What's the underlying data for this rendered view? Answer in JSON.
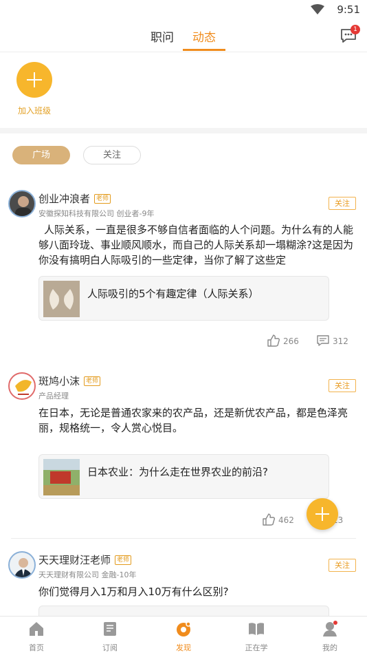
{
  "status_bar": {
    "time": "9:51"
  },
  "header": {
    "tabs": [
      {
        "label": "职问"
      },
      {
        "label": "动态"
      }
    ],
    "active_tab": "动态",
    "message_badge": "1"
  },
  "join_class": {
    "label": "加入班级"
  },
  "filters": {
    "square": "广场",
    "follow": "关注"
  },
  "posts": [
    {
      "author": "创业冲浪者",
      "tag": "老师",
      "meta": "安徽探知科技有限公司  创业者-9年",
      "follow_label": "关注",
      "text": "人际关系，一直是很多不够自信者面临的人个问题。为什么有的人能够八面玲珑、事业顺风顺水，而自己的人际关系却一塌糊涂?这是因为你没有搞明白人际吸引的一些定律，当你了解了这些定",
      "link_title": "人际吸引的5个有趣定律（人际关系）",
      "likes": "266",
      "comments": "312"
    },
    {
      "author": "斑鸠小沫",
      "tag": "老师",
      "meta": "产品经理",
      "follow_label": "关注",
      "text": "在日本，无论是普通农家来的农产品，还是新优农产品，都是色泽亮丽，规格统一，令人赏心悦目。",
      "link_title": "日本农业：为什么走在世界农业的前沿?",
      "likes": "462",
      "comments": "13"
    },
    {
      "author": "天天理财汪老师",
      "tag": "老师",
      "meta": "天天理财有限公司  金融-10年",
      "follow_label": "关注",
      "text": "你们觉得月入1万和月入10万有什么区别?"
    }
  ],
  "bottom_nav": [
    {
      "label": "首页",
      "icon": "home-icon"
    },
    {
      "label": "订阅",
      "icon": "bookmark-icon"
    },
    {
      "label": "发现",
      "icon": "discover-icon"
    },
    {
      "label": "正在学",
      "icon": "book-icon"
    },
    {
      "label": "我的",
      "icon": "profile-icon"
    }
  ],
  "colors": {
    "accent": "#f08c1d",
    "fab": "#f7b62c",
    "pill_active": "#d9b27a"
  }
}
